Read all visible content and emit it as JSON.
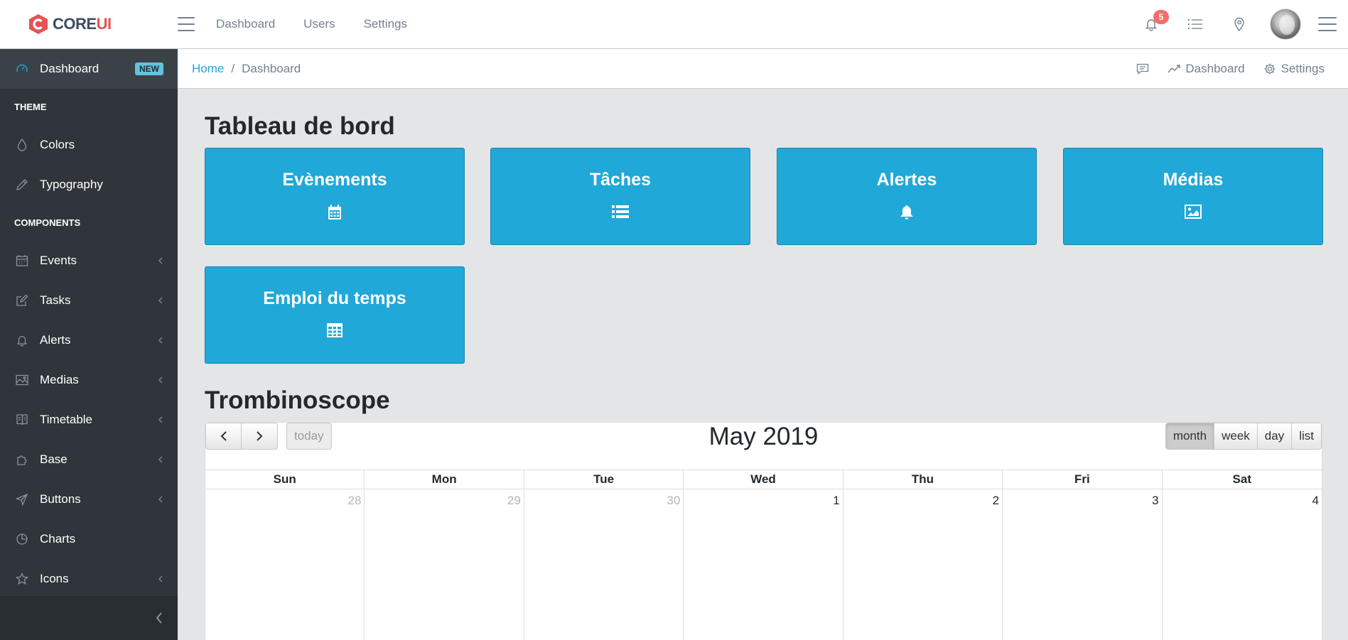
{
  "brand": {
    "name_main": "CORE",
    "name_accent": "UI",
    "color": "#e55353"
  },
  "header": {
    "nav": [
      "Dashboard",
      "Users",
      "Settings"
    ],
    "notification_count": "5"
  },
  "sidebar": {
    "dashboard": {
      "label": "Dashboard",
      "badge": "NEW"
    },
    "theme_title": "THEME",
    "theme_items": [
      "Colors",
      "Typography"
    ],
    "components_title": "COMPONENTS",
    "component_items": [
      {
        "label": "Events",
        "icon": "calendar-icon"
      },
      {
        "label": "Tasks",
        "icon": "edit-icon"
      },
      {
        "label": "Alerts",
        "icon": "bell-icon"
      },
      {
        "label": "Medias",
        "icon": "image-icon"
      },
      {
        "label": "Timetable",
        "icon": "book-icon"
      },
      {
        "label": "Base",
        "icon": "puzzle-icon"
      },
      {
        "label": "Buttons",
        "icon": "cursor-icon"
      },
      {
        "label": "Charts",
        "icon": "pie-chart-icon"
      },
      {
        "label": "Icons",
        "icon": "star-icon"
      }
    ]
  },
  "breadcrumb": {
    "home": "Home",
    "separator": "/",
    "current": "Dashboard",
    "right_dashboard": "Dashboard",
    "right_settings": "Settings"
  },
  "main": {
    "heading_dashboard": "Tableau de bord",
    "tiles": [
      {
        "title": "Evènements",
        "icon": "calendar-icon"
      },
      {
        "title": "Tâches",
        "icon": "list-icon"
      },
      {
        "title": "Alertes",
        "icon": "bell-icon"
      },
      {
        "title": "Médias",
        "icon": "image-icon"
      },
      {
        "title": "Emploi du temps",
        "icon": "table-icon"
      }
    ],
    "heading_trombinoscope": "Trombinoscope",
    "tile_color": "#20a8d8"
  },
  "calendar": {
    "title": "May 2019",
    "today_label": "today",
    "views": [
      "month",
      "week",
      "day",
      "list"
    ],
    "active_view": "month",
    "weekdays": [
      "Sun",
      "Mon",
      "Tue",
      "Wed",
      "Thu",
      "Fri",
      "Sat"
    ],
    "first_week": [
      "28",
      "29",
      "30",
      "1",
      "2",
      "3",
      "4"
    ]
  }
}
